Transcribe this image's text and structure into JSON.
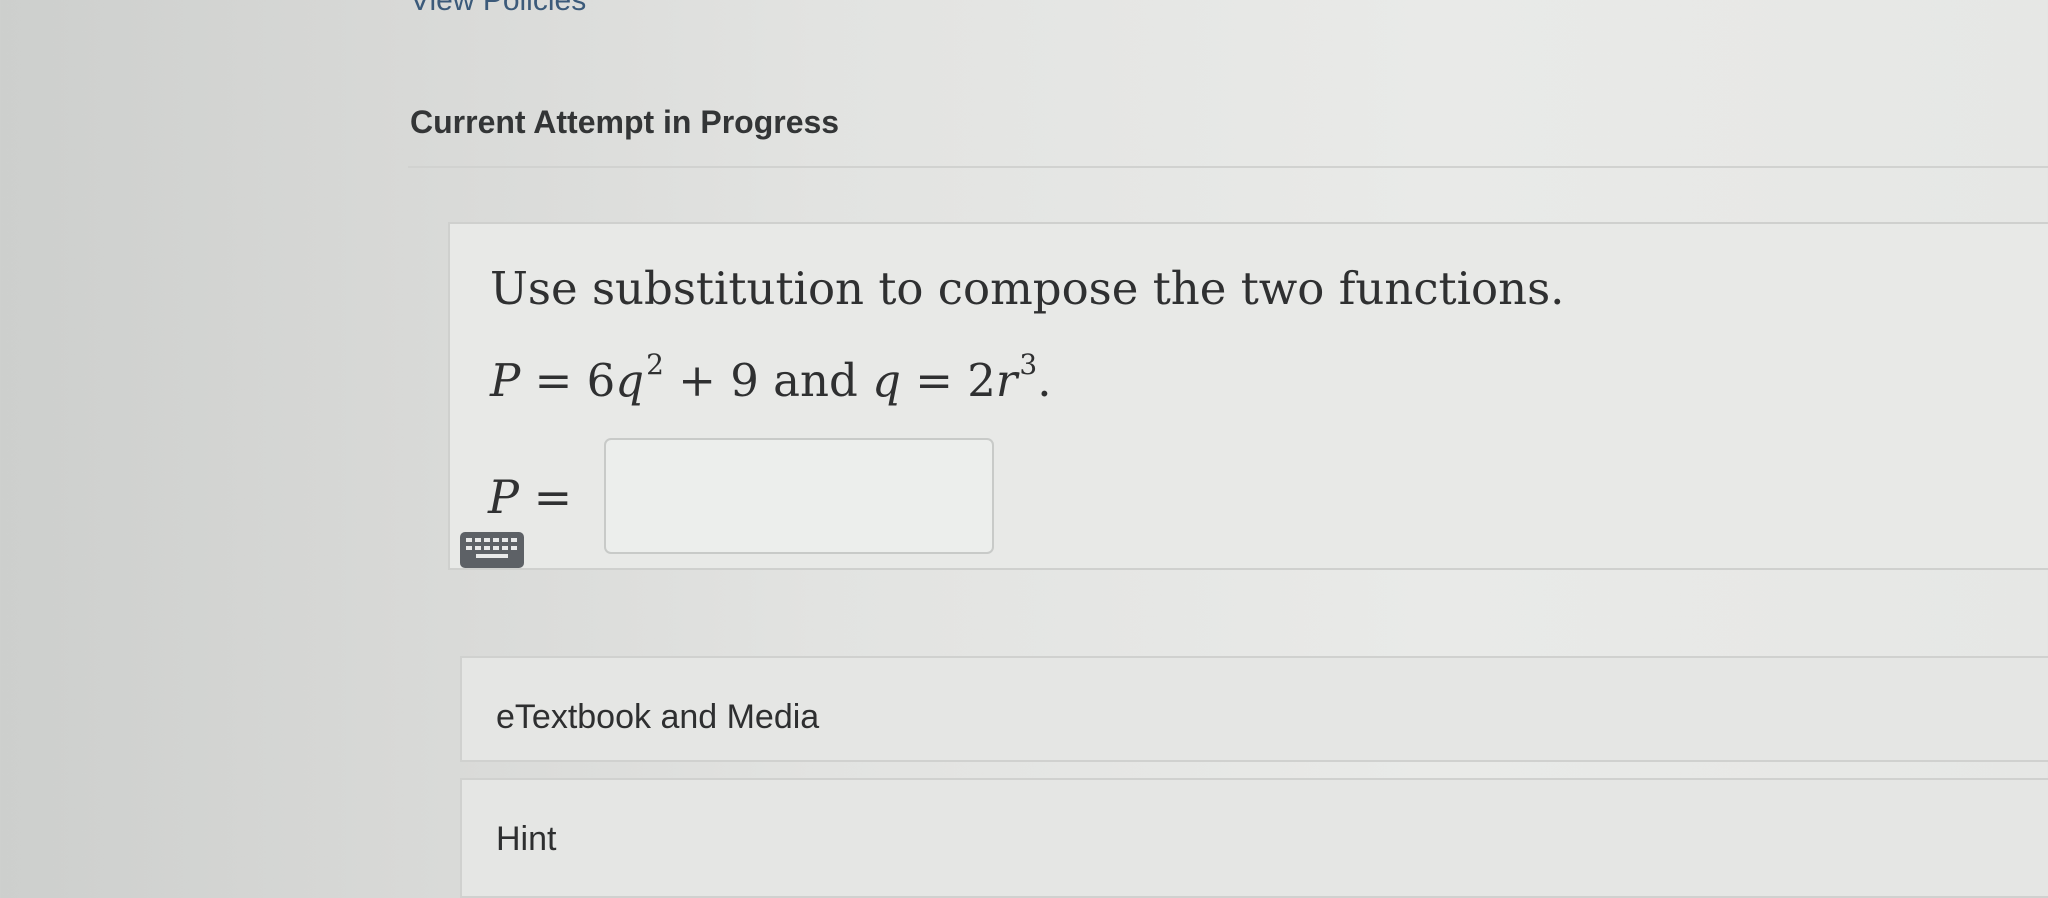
{
  "header": {
    "view_policies_link": "View Policies",
    "attempt_heading": "Current Attempt in Progress"
  },
  "question": {
    "instruction": "Use substitution to compose the two functions.",
    "eq1": {
      "var": "P",
      "eq": "=",
      "coef": "6",
      "base": "q",
      "exp": "2",
      "rest": "+ 9"
    },
    "conj": "and",
    "eq2": {
      "var": "q",
      "eq": "=",
      "coef": "2",
      "base": "r",
      "exp": "3",
      "end": "."
    },
    "answer": {
      "lhs_var": "P",
      "lhs_eq": "=",
      "value": "",
      "placeholder": ""
    },
    "keyboard_icon": "keyboard-icon"
  },
  "resources": {
    "etextbook_label": "eTextbook and Media",
    "hint_label": "Hint"
  }
}
